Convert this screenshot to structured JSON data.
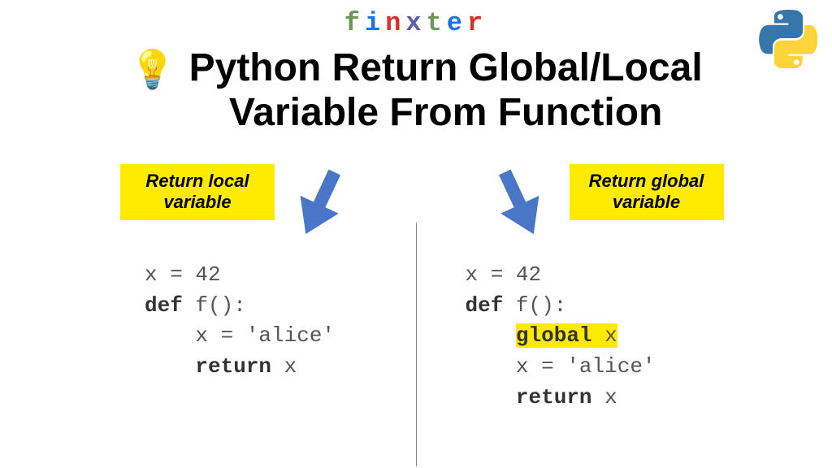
{
  "brand": "finxter",
  "title": "Python Return Global/Local\nVariable From Function",
  "left": {
    "label": "Return local\nvariable",
    "code_line1": "x = 42",
    "code_def": "def",
    "code_sig": " f():",
    "code_assign": "    x = 'alice'",
    "code_ret_kw": "return",
    "code_ret_var": " x"
  },
  "right": {
    "label": "Return global\nvariable",
    "code_line1": "x = 42",
    "code_def": "def",
    "code_sig": " f():",
    "code_global_kw": "global",
    "code_global_var": " x",
    "code_assign": "    x = 'alice'",
    "code_ret_kw": "return",
    "code_ret_var": " x"
  }
}
